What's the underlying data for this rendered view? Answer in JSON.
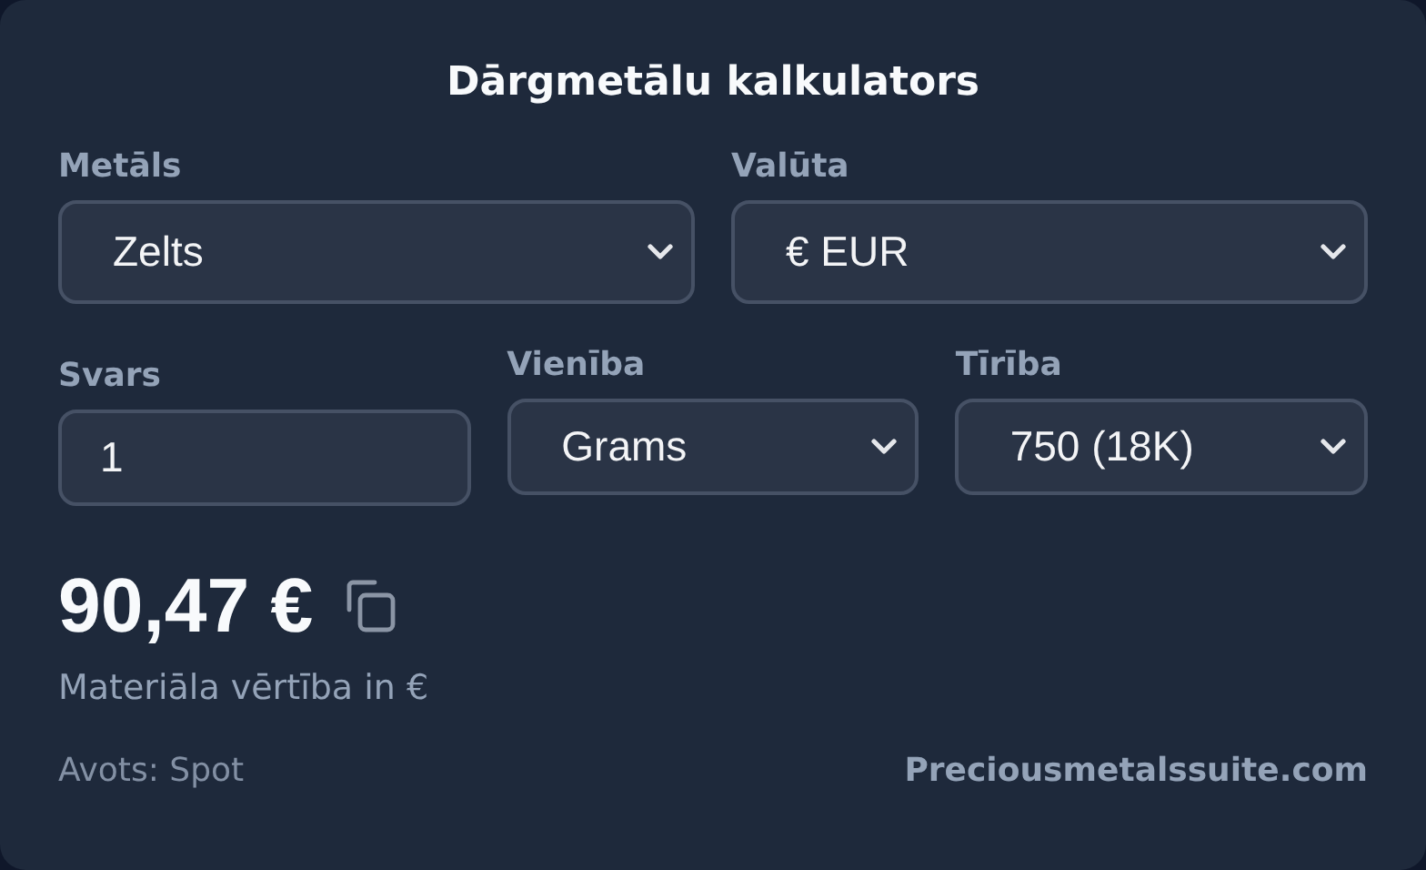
{
  "title": "Dārgmetālu kalkulators",
  "row_1": [
    {
      "kind": "select",
      "label": "Metāls",
      "value": "Zelts"
    },
    {
      "kind": "select",
      "label": "Valūta",
      "value": "€ EUR"
    }
  ],
  "row_2": [
    {
      "kind": "input",
      "label": "Svars",
      "value": "1"
    },
    {
      "kind": "select",
      "label": "Vienība",
      "value": "Grams"
    },
    {
      "kind": "select",
      "label": "Tīrība",
      "value": "750 (18K)"
    }
  ],
  "result": {
    "value": "90,47 €",
    "caption": "Materiāla vērtība in €"
  },
  "footer": {
    "source": "Avots: Spot",
    "link": "Preciousmetalssuite.com"
  }
}
